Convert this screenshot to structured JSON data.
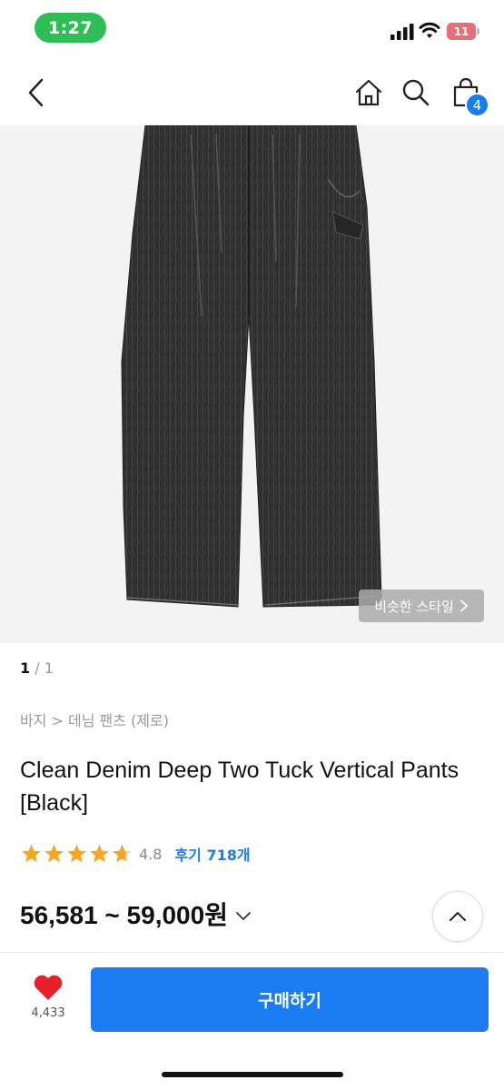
{
  "status_bar": {
    "time": "1:27",
    "battery": "11",
    "colors": {
      "time_pill": "#2fbe55",
      "battery": "#e4707a"
    }
  },
  "nav": {
    "icons": [
      "back-icon",
      "home-icon",
      "search-icon",
      "cart-icon"
    ],
    "cart_badge": "4",
    "accent": "#1a7cf0"
  },
  "gallery": {
    "similar_style_label": "비슷한 스타일",
    "pager_current": "1",
    "pager_total": "/ 1"
  },
  "product": {
    "breadcrumb": "바지 > 데님 팬츠 (제로)",
    "title": "Clean Denim Deep Two Tuck Vertical Pants [Black]",
    "rating_value": "4.8",
    "stars": 4.8,
    "review_label": "후기 718개",
    "price": "56,581 ~ 59,000원"
  },
  "footer": {
    "like_count": "4,433",
    "buy_label": "구매하기"
  }
}
